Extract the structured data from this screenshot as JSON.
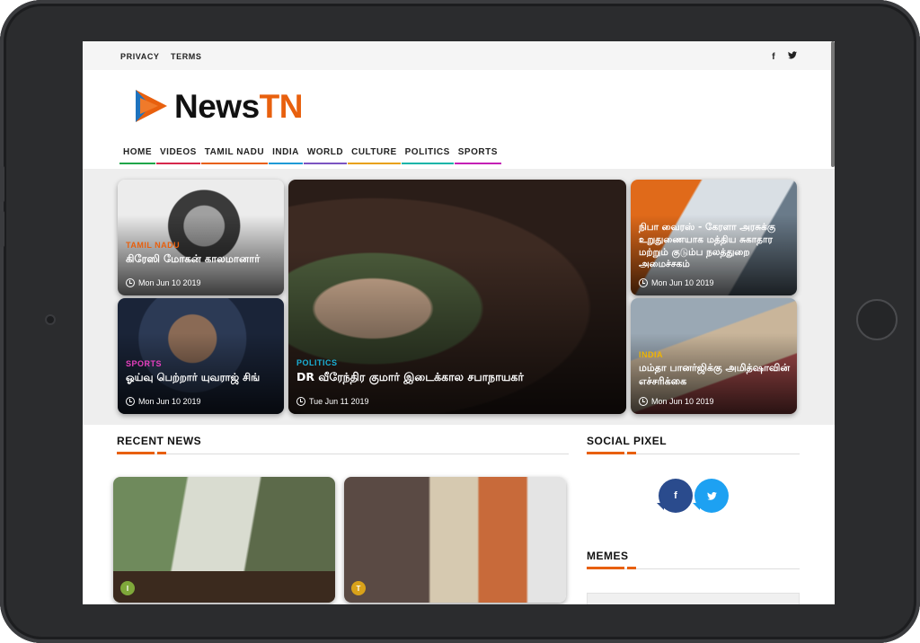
{
  "brand": {
    "name_part1": "News",
    "name_part2": "TN",
    "accent_color": "#e8600e",
    "play_icon": "play-triangle-logo"
  },
  "topbar": {
    "links": [
      "PRIVACY",
      "TERMS"
    ],
    "social": [
      {
        "icon": "facebook-icon",
        "glyph": "f"
      },
      {
        "icon": "twitter-icon",
        "glyph": "🐦"
      }
    ]
  },
  "nav": {
    "items": [
      {
        "label": "HOME",
        "color": "#1fa64a"
      },
      {
        "label": "VIDEOS",
        "color": "#d6284b"
      },
      {
        "label": "TAMIL NADU",
        "color": "#e8600e"
      },
      {
        "label": "INDIA",
        "color": "#1e9ad6"
      },
      {
        "label": "WORLD",
        "color": "#7b53c1"
      },
      {
        "label": "CULTURE",
        "color": "#e8a10e"
      },
      {
        "label": "POLITICS",
        "color": "#0fb5a8"
      },
      {
        "label": "SPORTS",
        "color": "#c41fb5"
      }
    ]
  },
  "hero": {
    "tiles": [
      {
        "category": "TAMIL NADU",
        "category_color": "#e8600e",
        "title": "கிரேஸி மோகன் காலமானார்",
        "date": "Mon Jun 10 2019"
      },
      {
        "category": "SPORTS",
        "category_color": "#e83fbf",
        "title": "ஓய்வு பெற்றார் யுவராஜ் சிங்",
        "date": "Mon Jun 10 2019"
      },
      {
        "category": "POLITICS",
        "category_color": "#1ab0d6",
        "title": "DR வீரேந்திர குமார் இடைக்கால சபாநாயகர்",
        "date": "Tue Jun 11 2019"
      },
      {
        "category": "",
        "category_color": "#ffffff",
        "title": "நிபா வைரஸ் - கேரளா அரசுக்கு உறுதுணையாக மத்திய சுகாதார மற்றும் குடும்ப நலத்துறை அமைச்சகம்",
        "date": "Mon Jun 10 2019"
      },
      {
        "category": "INDIA",
        "category_color": "#f0b400",
        "title": "மம்தா பானர்ஜிக்கு அமித்ஷாவின் எச்சரிக்கை",
        "date": "Mon Jun 10 2019"
      }
    ]
  },
  "recent": {
    "title": "RECENT NEWS",
    "cards": [
      {
        "badge": "I",
        "badge_color": "#7fa83a"
      },
      {
        "badge": "T",
        "badge_color": "#d9a21a"
      }
    ]
  },
  "social_pixel": {
    "title": "SOCIAL PIXEL",
    "facebook": {
      "glyph": "f",
      "color": "#2a4b8d"
    },
    "twitter": {
      "glyph": "🐦",
      "color": "#1da1f2"
    }
  },
  "memes": {
    "title": "MEMES"
  }
}
